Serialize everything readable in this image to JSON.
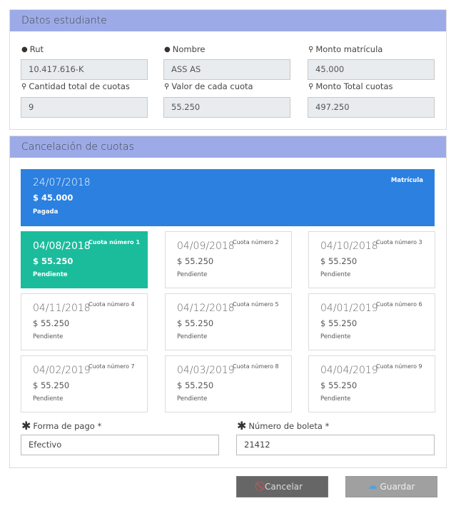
{
  "student": {
    "title": "Datos estudiante",
    "fields": [
      {
        "label": "Rut",
        "icon": "user-icon",
        "value": "10.417.616-K"
      },
      {
        "label": "Nombre",
        "icon": "user-icon",
        "value": "ASS AS"
      },
      {
        "label": "Monto matrícula",
        "icon": "key-icon",
        "value": "45.000"
      },
      {
        "label": "Cantidad total de cuotas",
        "icon": "key-icon",
        "value": "9"
      },
      {
        "label": "Valor de cada cuota",
        "icon": "key-icon",
        "value": "55.250"
      },
      {
        "label": "Monto Total cuotas",
        "icon": "key-icon",
        "value": "497.250"
      }
    ]
  },
  "payments": {
    "title": "Cancelación de cuotas",
    "matricula": {
      "date": "24/07/2018",
      "amount": "$ 45.000",
      "status": "Pagada",
      "label": "Matrícula"
    },
    "cuotas": [
      {
        "date": "04/08/2018",
        "label": "Cuota número 1",
        "amount": "$ 55.250",
        "status": "Pendiente"
      },
      {
        "date": "04/09/2018",
        "label": "Cuota número 2",
        "amount": "$ 55.250",
        "status": "Pendiente"
      },
      {
        "date": "04/10/2018",
        "label": "Cuota número 3",
        "amount": "$ 55.250",
        "status": "Pendiente"
      },
      {
        "date": "04/11/2018",
        "label": "Cuota número 4",
        "amount": "$ 55.250",
        "status": "Pendiente"
      },
      {
        "date": "04/12/2018",
        "label": "Cuota número 5",
        "amount": "$ 55.250",
        "status": "Pendiente"
      },
      {
        "date": "04/01/2019",
        "label": "Cuota número 6",
        "amount": "$ 55.250",
        "status": "Pendiente"
      },
      {
        "date": "04/02/2019",
        "label": "Cuota número 7",
        "amount": "$ 55.250",
        "status": "Pendiente"
      },
      {
        "date": "04/03/2019",
        "label": "Cuota número 8",
        "amount": "$ 55.250",
        "status": "Pendiente"
      },
      {
        "date": "04/04/2019",
        "label": "Cuota número 9",
        "amount": "$ 55.250",
        "status": "Pendiente"
      }
    ],
    "forma_pago": {
      "label": "Forma de pago *",
      "value": "Efectivo"
    },
    "boleta": {
      "label": "Número de boleta *",
      "value": "21412"
    }
  },
  "actions": {
    "cancel": "Cancelar",
    "save": "Guardar"
  },
  "colors": {
    "header": "#9cabe8",
    "matricula": "#2b80e0",
    "active": "#1abc9c"
  }
}
